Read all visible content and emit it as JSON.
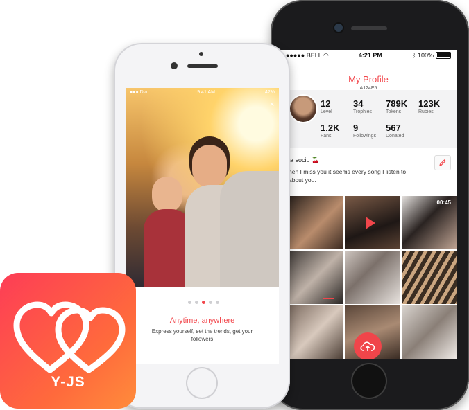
{
  "right_phone": {
    "status": {
      "carrier": "BELL",
      "time": "4:21 PM",
      "battery": "100%"
    },
    "profile": {
      "title": "My Profile",
      "id": "A124E5",
      "stats": [
        {
          "value": "12",
          "label": "Level"
        },
        {
          "value": "34",
          "label": "Trophies"
        },
        {
          "value": "789K",
          "label": "Tokens"
        },
        {
          "value": "123K",
          "label": "Rubies"
        },
        {
          "value": "1.2K",
          "label": "Fans"
        },
        {
          "value": "9",
          "label": "Followings"
        },
        {
          "value": "567",
          "label": "Donated"
        }
      ],
      "username": "ia sociu 🍒",
      "bio": "hen I miss you it seems every song I listen to  about you."
    },
    "media": {
      "video_duration": "00:45"
    },
    "accent": "#f2464b"
  },
  "left_phone": {
    "status": {
      "carrier": "Dia",
      "time": "9:41 AM",
      "battery": "42%"
    },
    "close": "×",
    "onboarding": {
      "title": "Anytime, anywhere",
      "description": "Express yourself, set the trends, get your followers",
      "page_count": 5,
      "active_page": 3
    }
  },
  "app_icon": {
    "name": "Y-JS",
    "gradient": [
      "#fd3d56",
      "#ff8c3b"
    ]
  }
}
